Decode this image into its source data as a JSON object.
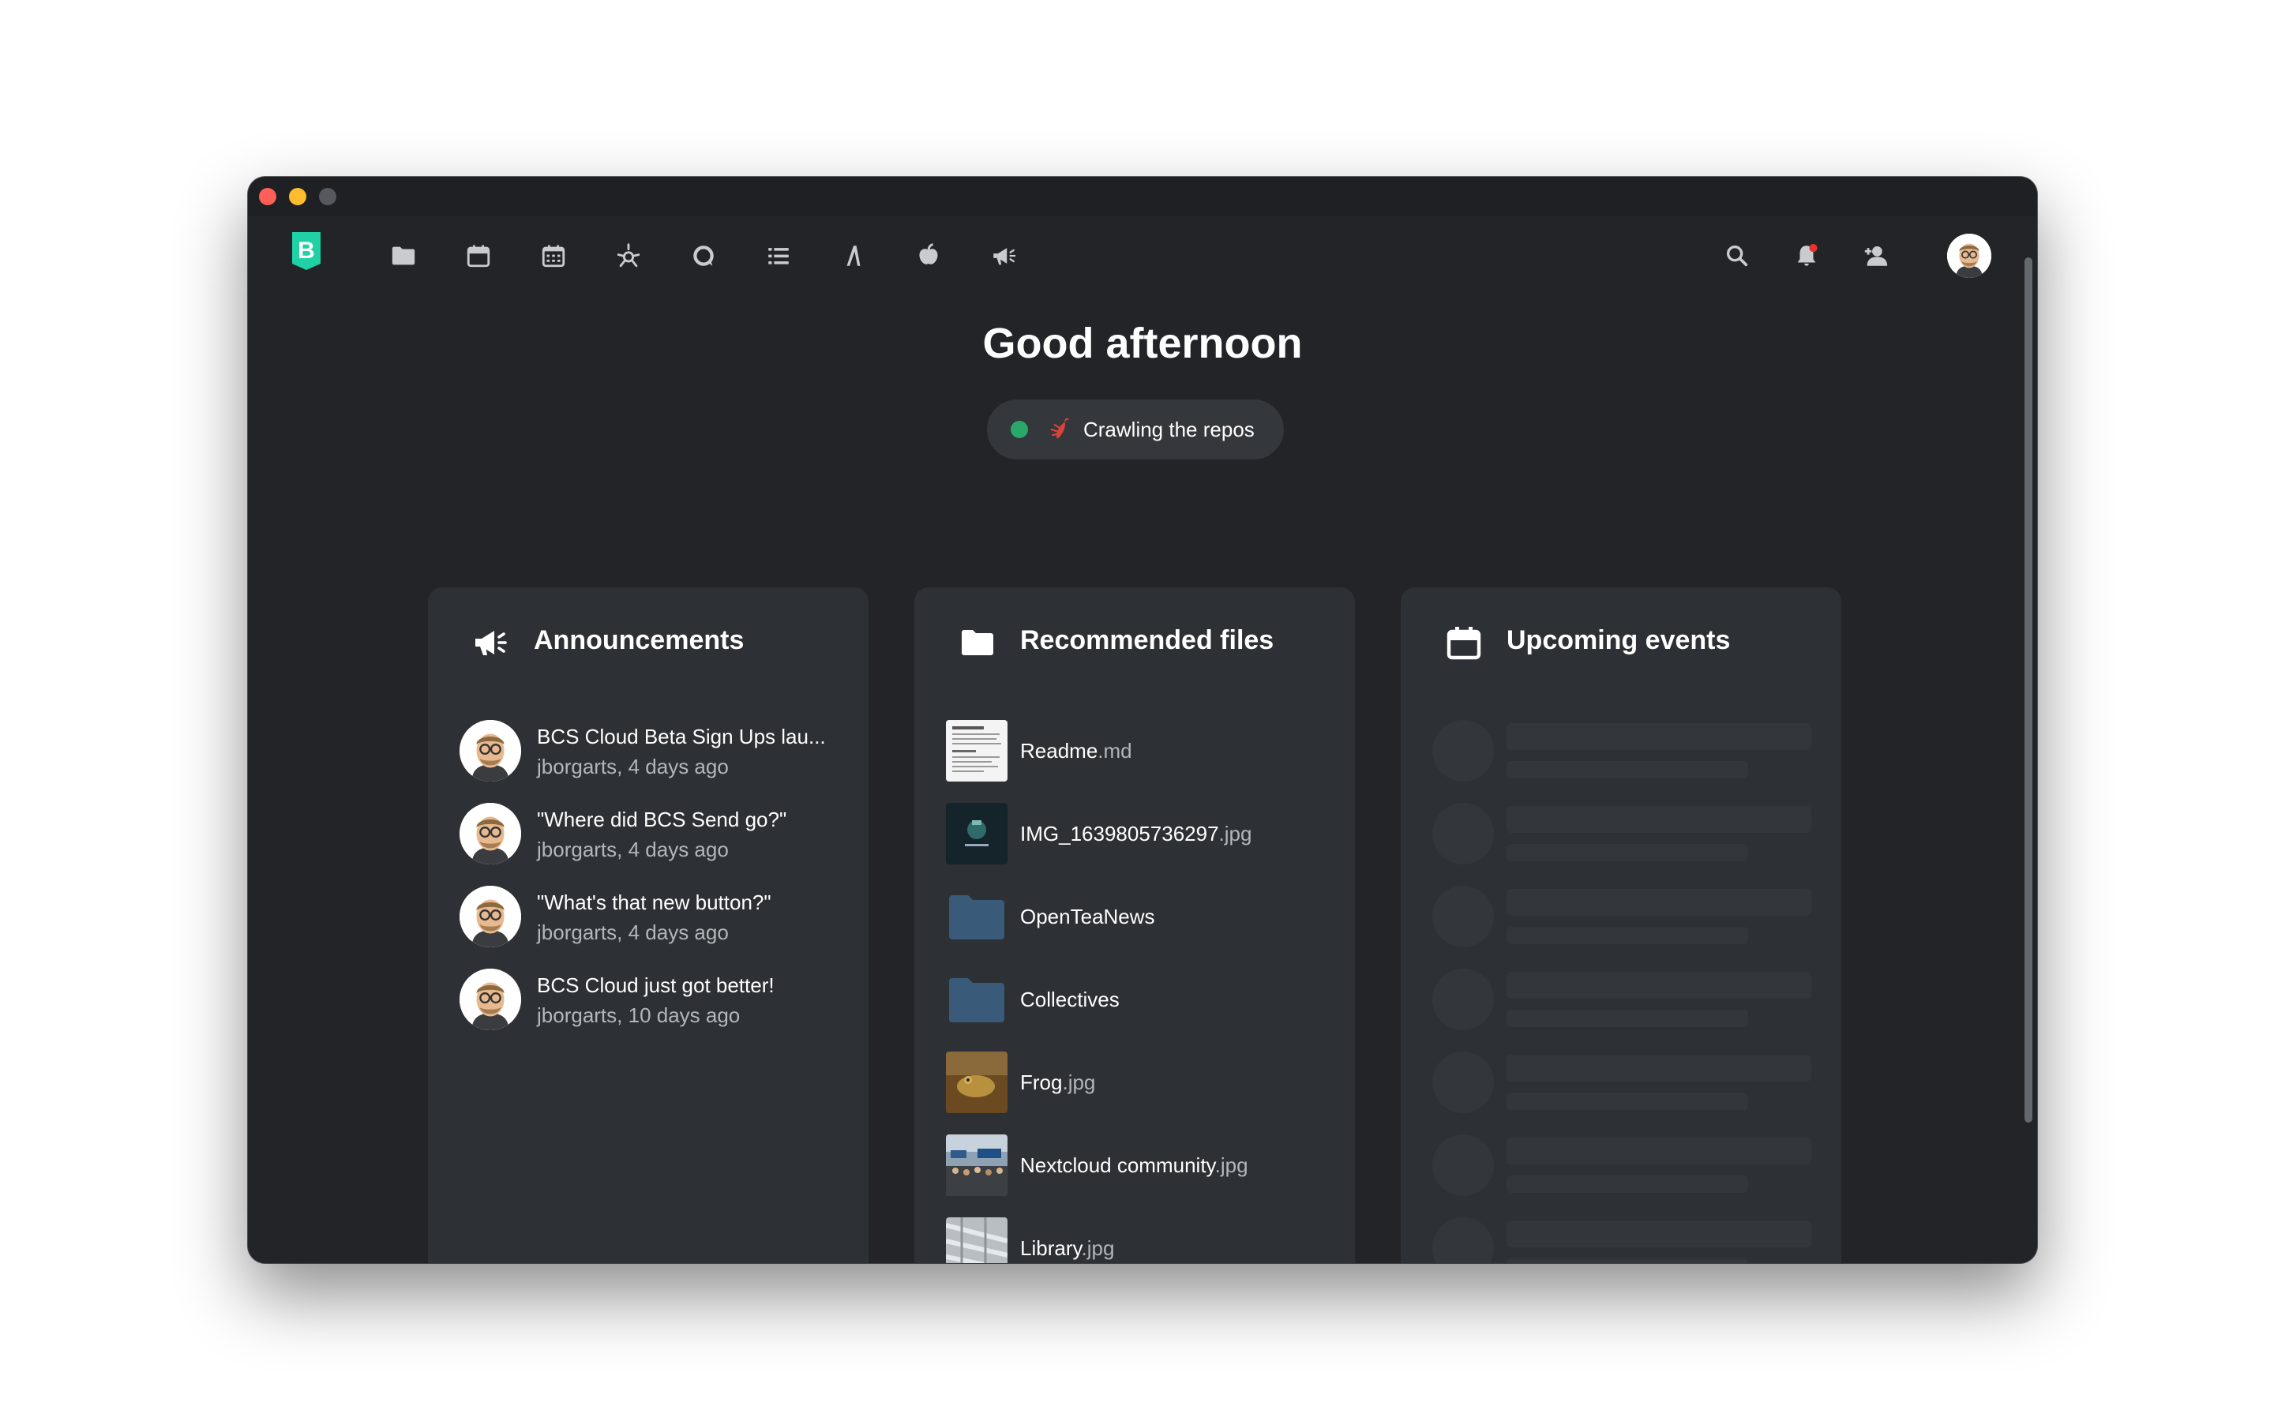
{
  "header": {
    "nav": [
      {
        "name": "files-icon"
      },
      {
        "name": "calendar-icon"
      },
      {
        "name": "calendar-grid-icon"
      },
      {
        "name": "activity-icon"
      },
      {
        "name": "talk-icon"
      },
      {
        "name": "tasks-icon"
      },
      {
        "name": "text-icon"
      },
      {
        "name": "deck-icon"
      },
      {
        "name": "announcements-icon"
      }
    ],
    "right_icons": [
      "search-icon",
      "notifications-icon",
      "contacts-icon",
      "user-avatar"
    ],
    "notification_dot_color": "#e9322d"
  },
  "greeting": "Good afternoon",
  "status": {
    "text": "Crawling the repos",
    "dot_color": "#2aa86a",
    "emoji": "lobster"
  },
  "panels": {
    "announcements": {
      "title": "Announcements",
      "items": [
        {
          "title": "BCS Cloud Beta Sign Ups lau...",
          "subtitle": "jborgarts, 4 days ago"
        },
        {
          "title": "\"Where did BCS Send go?\"",
          "subtitle": "jborgarts, 4 days ago"
        },
        {
          "title": "\"What's that new button?\"",
          "subtitle": "jborgarts, 4 days ago"
        },
        {
          "title": "BCS Cloud just got better!",
          "subtitle": "jborgarts, 10 days ago"
        }
      ]
    },
    "files": {
      "title": "Recommended files",
      "items": [
        {
          "name": "Readme",
          "ext": ".md",
          "kind": "document"
        },
        {
          "name": "IMG_1639805736297",
          "ext": ".jpg",
          "kind": "image-dark"
        },
        {
          "name": "OpenTeaNews",
          "ext": "",
          "kind": "folder"
        },
        {
          "name": "Collectives",
          "ext": "",
          "kind": "folder"
        },
        {
          "name": "Frog",
          "ext": ".jpg",
          "kind": "image-frog"
        },
        {
          "name": "Nextcloud community",
          "ext": ".jpg",
          "kind": "image-crowd"
        },
        {
          "name": "Library",
          "ext": ".jpg",
          "kind": "image-library"
        }
      ]
    },
    "events": {
      "title": "Upcoming events",
      "loading": true
    }
  },
  "colors": {
    "background": "#222427",
    "panel": "#2d3034",
    "folder": "#3a5a7a",
    "logo": "#1fd1a4"
  }
}
